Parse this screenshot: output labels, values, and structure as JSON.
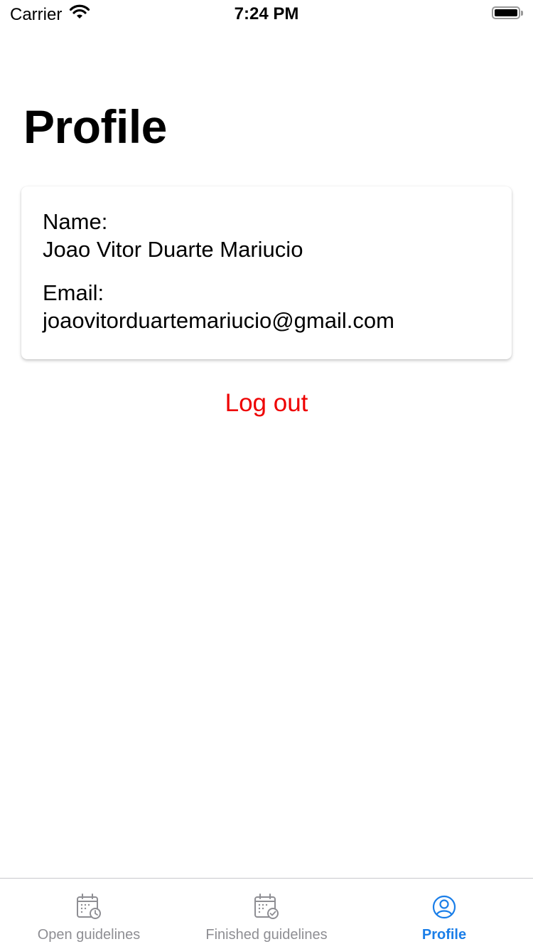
{
  "status_bar": {
    "carrier": "Carrier",
    "time": "7:24 PM",
    "wifi_icon": "wifi-icon",
    "battery_icon": "battery-icon"
  },
  "page": {
    "title": "Profile"
  },
  "profile": {
    "name_label": "Name:",
    "name_value": "Joao Vitor Duarte Mariucio",
    "email_label": "Email:",
    "email_value": "joaovitorduartemariucio@gmail.com"
  },
  "logout": {
    "label": "Log out",
    "color": "#ee0000"
  },
  "tab_bar": {
    "active_color": "#1a7ee8",
    "inactive_color": "#8e8e93",
    "items": [
      {
        "label": "Open guidelines",
        "icon": "calendar-clock-icon",
        "active": false
      },
      {
        "label": "Finished guidelines",
        "icon": "calendar-check-icon",
        "active": false
      },
      {
        "label": "Profile",
        "icon": "user-circle-icon",
        "active": true
      }
    ]
  }
}
